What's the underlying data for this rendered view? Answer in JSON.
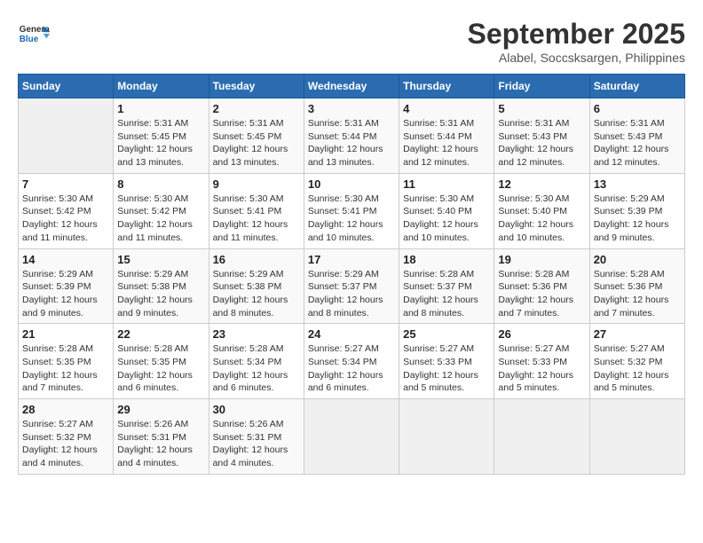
{
  "header": {
    "logo": {
      "line1": "General",
      "line2": "Blue"
    },
    "title": "September 2025",
    "location": "Alabel, Soccsksargen, Philippines"
  },
  "calendar": {
    "weekdays": [
      "Sunday",
      "Monday",
      "Tuesday",
      "Wednesday",
      "Thursday",
      "Friday",
      "Saturday"
    ],
    "weeks": [
      [
        {
          "day": "",
          "info": ""
        },
        {
          "day": "1",
          "info": "Sunrise: 5:31 AM\nSunset: 5:45 PM\nDaylight: 12 hours\nand 13 minutes."
        },
        {
          "day": "2",
          "info": "Sunrise: 5:31 AM\nSunset: 5:45 PM\nDaylight: 12 hours\nand 13 minutes."
        },
        {
          "day": "3",
          "info": "Sunrise: 5:31 AM\nSunset: 5:44 PM\nDaylight: 12 hours\nand 13 minutes."
        },
        {
          "day": "4",
          "info": "Sunrise: 5:31 AM\nSunset: 5:44 PM\nDaylight: 12 hours\nand 12 minutes."
        },
        {
          "day": "5",
          "info": "Sunrise: 5:31 AM\nSunset: 5:43 PM\nDaylight: 12 hours\nand 12 minutes."
        },
        {
          "day": "6",
          "info": "Sunrise: 5:31 AM\nSunset: 5:43 PM\nDaylight: 12 hours\nand 12 minutes."
        }
      ],
      [
        {
          "day": "7",
          "info": "Sunrise: 5:30 AM\nSunset: 5:42 PM\nDaylight: 12 hours\nand 11 minutes."
        },
        {
          "day": "8",
          "info": "Sunrise: 5:30 AM\nSunset: 5:42 PM\nDaylight: 12 hours\nand 11 minutes."
        },
        {
          "day": "9",
          "info": "Sunrise: 5:30 AM\nSunset: 5:41 PM\nDaylight: 12 hours\nand 11 minutes."
        },
        {
          "day": "10",
          "info": "Sunrise: 5:30 AM\nSunset: 5:41 PM\nDaylight: 12 hours\nand 10 minutes."
        },
        {
          "day": "11",
          "info": "Sunrise: 5:30 AM\nSunset: 5:40 PM\nDaylight: 12 hours\nand 10 minutes."
        },
        {
          "day": "12",
          "info": "Sunrise: 5:30 AM\nSunset: 5:40 PM\nDaylight: 12 hours\nand 10 minutes."
        },
        {
          "day": "13",
          "info": "Sunrise: 5:29 AM\nSunset: 5:39 PM\nDaylight: 12 hours\nand 9 minutes."
        }
      ],
      [
        {
          "day": "14",
          "info": "Sunrise: 5:29 AM\nSunset: 5:39 PM\nDaylight: 12 hours\nand 9 minutes."
        },
        {
          "day": "15",
          "info": "Sunrise: 5:29 AM\nSunset: 5:38 PM\nDaylight: 12 hours\nand 9 minutes."
        },
        {
          "day": "16",
          "info": "Sunrise: 5:29 AM\nSunset: 5:38 PM\nDaylight: 12 hours\nand 8 minutes."
        },
        {
          "day": "17",
          "info": "Sunrise: 5:29 AM\nSunset: 5:37 PM\nDaylight: 12 hours\nand 8 minutes."
        },
        {
          "day": "18",
          "info": "Sunrise: 5:28 AM\nSunset: 5:37 PM\nDaylight: 12 hours\nand 8 minutes."
        },
        {
          "day": "19",
          "info": "Sunrise: 5:28 AM\nSunset: 5:36 PM\nDaylight: 12 hours\nand 7 minutes."
        },
        {
          "day": "20",
          "info": "Sunrise: 5:28 AM\nSunset: 5:36 PM\nDaylight: 12 hours\nand 7 minutes."
        }
      ],
      [
        {
          "day": "21",
          "info": "Sunrise: 5:28 AM\nSunset: 5:35 PM\nDaylight: 12 hours\nand 7 minutes."
        },
        {
          "day": "22",
          "info": "Sunrise: 5:28 AM\nSunset: 5:35 PM\nDaylight: 12 hours\nand 6 minutes."
        },
        {
          "day": "23",
          "info": "Sunrise: 5:28 AM\nSunset: 5:34 PM\nDaylight: 12 hours\nand 6 minutes."
        },
        {
          "day": "24",
          "info": "Sunrise: 5:27 AM\nSunset: 5:34 PM\nDaylight: 12 hours\nand 6 minutes."
        },
        {
          "day": "25",
          "info": "Sunrise: 5:27 AM\nSunset: 5:33 PM\nDaylight: 12 hours\nand 5 minutes."
        },
        {
          "day": "26",
          "info": "Sunrise: 5:27 AM\nSunset: 5:33 PM\nDaylight: 12 hours\nand 5 minutes."
        },
        {
          "day": "27",
          "info": "Sunrise: 5:27 AM\nSunset: 5:32 PM\nDaylight: 12 hours\nand 5 minutes."
        }
      ],
      [
        {
          "day": "28",
          "info": "Sunrise: 5:27 AM\nSunset: 5:32 PM\nDaylight: 12 hours\nand 4 minutes."
        },
        {
          "day": "29",
          "info": "Sunrise: 5:26 AM\nSunset: 5:31 PM\nDaylight: 12 hours\nand 4 minutes."
        },
        {
          "day": "30",
          "info": "Sunrise: 5:26 AM\nSunset: 5:31 PM\nDaylight: 12 hours\nand 4 minutes."
        },
        {
          "day": "",
          "info": ""
        },
        {
          "day": "",
          "info": ""
        },
        {
          "day": "",
          "info": ""
        },
        {
          "day": "",
          "info": ""
        }
      ]
    ]
  }
}
